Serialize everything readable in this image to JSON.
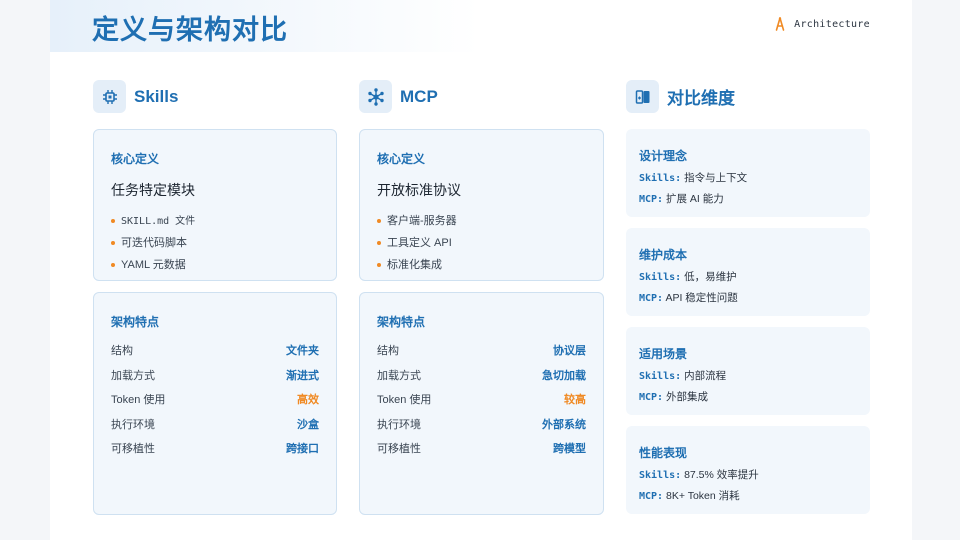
{
  "header": {
    "title": "定义与架构对比",
    "brand": "Architecture"
  },
  "colors": {
    "accent": "#1f6fb2",
    "warning": "#f08a24",
    "card_bg": "#f2f7fc"
  },
  "columns": [
    {
      "heading": "Skills",
      "icon": "chip-icon",
      "core": {
        "title": "核心定义",
        "subtitle": "任务特定模块",
        "bullets": [
          "SKILL.md 文件",
          "可迭代码脚本",
          "YAML 元数据"
        ]
      },
      "features": {
        "title": "架构特点",
        "rows": [
          {
            "key": "结构",
            "value": "文件夹",
            "highlight": false
          },
          {
            "key": "加载方式",
            "value": "渐进式",
            "highlight": false
          },
          {
            "key": "Token 使用",
            "value": "高效",
            "highlight": true
          },
          {
            "key": "执行环境",
            "value": "沙盒",
            "highlight": false
          },
          {
            "key": "可移植性",
            "value": "跨接口",
            "highlight": false
          }
        ]
      }
    },
    {
      "heading": "MCP",
      "icon": "network-hub-icon",
      "core": {
        "title": "核心定义",
        "subtitle": "开放标准协议",
        "bullets": [
          "客户端-服务器",
          "工具定义 API",
          "标准化集成"
        ]
      },
      "features": {
        "title": "架构特点",
        "rows": [
          {
            "key": "结构",
            "value": "协议层",
            "highlight": false
          },
          {
            "key": "加载方式",
            "value": "急切加载",
            "highlight": false
          },
          {
            "key": "Token 使用",
            "value": "较高",
            "highlight": true
          },
          {
            "key": "执行环境",
            "value": "外部系统",
            "highlight": false
          },
          {
            "key": "可移植性",
            "value": "跨模型",
            "highlight": false
          }
        ]
      }
    }
  ],
  "comparison": {
    "heading": "对比维度",
    "icon": "compare-icon",
    "cards": [
      {
        "title": "设计理念",
        "skills_key": "Skills:",
        "skills_val": "指令与上下文",
        "mcp_key": "MCP:",
        "mcp_val": "扩展 AI 能力"
      },
      {
        "title": "维护成本",
        "skills_key": "Skills:",
        "skills_val": "低，易维护",
        "mcp_key": "MCP:",
        "mcp_val": "API 稳定性问题"
      },
      {
        "title": "适用场景",
        "skills_key": "Skills:",
        "skills_val": "内部流程",
        "mcp_key": "MCP:",
        "mcp_val": "外部集成"
      },
      {
        "title": "性能表现",
        "skills_key": "Skills:",
        "skills_val": "87.5% 效率提升",
        "mcp_key": "MCP:",
        "mcp_val": "8K+ Token 消耗"
      }
    ]
  }
}
